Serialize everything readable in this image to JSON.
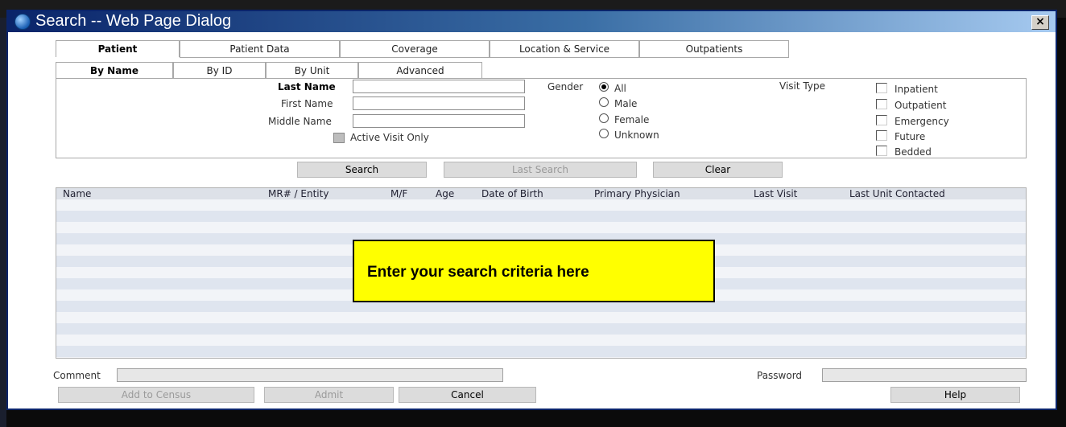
{
  "window": {
    "title": "Search -- Web Page Dialog",
    "close_label": "×"
  },
  "main_tabs": [
    {
      "label": "Patient",
      "active": true
    },
    {
      "label": "Patient Data"
    },
    {
      "label": "Coverage"
    },
    {
      "label": "Location & Service"
    },
    {
      "label": "Outpatients"
    }
  ],
  "sub_tabs": [
    {
      "label": "By Name",
      "active": true
    },
    {
      "label": "By ID"
    },
    {
      "label": "By Unit"
    },
    {
      "label": "Advanced"
    }
  ],
  "form": {
    "last_name_label": "Last Name",
    "first_name_label": "First Name",
    "middle_name_label": "Middle Name",
    "last_name_value": "",
    "first_name_value": "",
    "middle_name_value": "",
    "active_visit_label": "Active Visit Only",
    "active_visit_checked": false
  },
  "gender": {
    "label": "Gender",
    "selected": "All",
    "options": [
      "All",
      "Male",
      "Female",
      "Unknown"
    ]
  },
  "visit_type": {
    "label": "Visit Type",
    "options": [
      "Inpatient",
      "Outpatient",
      "Emergency",
      "Future",
      "Bedded"
    ]
  },
  "buttons": {
    "search": "Search",
    "last_search": "Last Search",
    "clear": "Clear",
    "add_to_census": "Add to Census",
    "admit": "Admit",
    "cancel": "Cancel",
    "help": "Help"
  },
  "results": {
    "columns": [
      "Name",
      "MR# / Entity",
      "M/F",
      "Age",
      "Date of Birth",
      "Primary Physician",
      "Last Visit",
      "Last Unit Contacted"
    ],
    "rows": []
  },
  "footer": {
    "comment_label": "Comment",
    "comment_value": "",
    "password_label": "Password",
    "password_value": ""
  },
  "callout": {
    "text": "Enter your search criteria here"
  },
  "colors": {
    "callout_bg": "#ffff00",
    "title_bar": "#0a246a"
  }
}
